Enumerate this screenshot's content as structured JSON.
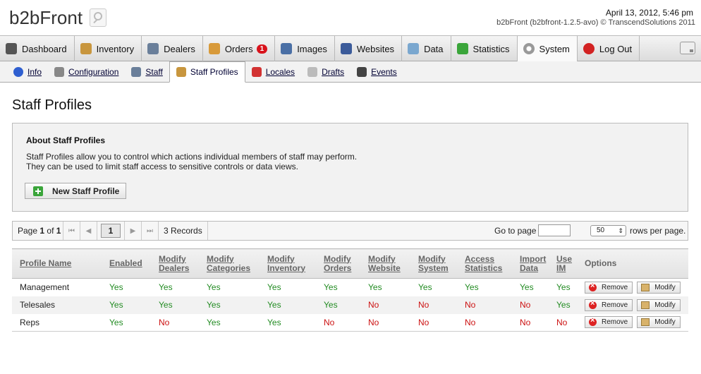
{
  "app": {
    "logo": "b2bFront",
    "datetime": "April 13, 2012, 5:46 pm",
    "version": "b2bFront (b2bfront-1.2.5-avo) © TranscendSolutions 2011"
  },
  "nav": {
    "tabs": [
      {
        "label": "Dashboard",
        "icon": "speedometer-icon",
        "color": "#555555"
      },
      {
        "label": "Inventory",
        "icon": "box-icon",
        "color": "#c8963e"
      },
      {
        "label": "Dealers",
        "icon": "person-icon",
        "color": "#6a7f9a"
      },
      {
        "label": "Orders",
        "icon": "orders-icon",
        "color": "#d89a3a",
        "badge": "1"
      },
      {
        "label": "Images",
        "icon": "images-icon",
        "color": "#4a6fa5"
      },
      {
        "label": "Websites",
        "icon": "website-icon",
        "color": "#3b5b9a"
      },
      {
        "label": "Data",
        "icon": "data-icon",
        "color": "#7aa7cf"
      },
      {
        "label": "Statistics",
        "icon": "chart-icon",
        "color": "#3aa53a"
      },
      {
        "label": "System",
        "icon": "gear-icon",
        "color": "#999999",
        "active": true
      },
      {
        "label": "Log Out",
        "icon": "logout-icon",
        "color": "#d22222"
      }
    ]
  },
  "subnav": {
    "tabs": [
      {
        "label": "Info",
        "icon": "info-icon",
        "color": "#2f5fd0"
      },
      {
        "label": "Configuration",
        "icon": "wrench-icon",
        "color": "#888888"
      },
      {
        "label": "Staff",
        "icon": "staff-icon",
        "color": "#6a7f9a"
      },
      {
        "label": "Staff Profiles",
        "icon": "staff-profiles-icon",
        "color": "#c8963e",
        "active": true
      },
      {
        "label": "Locales",
        "icon": "flag-icon",
        "color": "#d23232"
      },
      {
        "label": "Drafts",
        "icon": "document-icon",
        "color": "#bbbbbb"
      },
      {
        "label": "Events",
        "icon": "monitor-icon",
        "color": "#444444"
      }
    ]
  },
  "page": {
    "title": "Staff Profiles",
    "about_title": "About Staff Profiles",
    "about_line1": "Staff Profiles allow you to control which actions individual members of staff may perform.",
    "about_line2": "They can be used to limit staff access to sensitive controls or data views.",
    "new_button": "New Staff Profile"
  },
  "pager": {
    "page_label": "Page",
    "page_num": "1",
    "of_label": "of",
    "page_total": "1",
    "first": "⏮",
    "prev": "◀",
    "current": "1",
    "next": "▶",
    "last": "⏭",
    "records": "3 Records",
    "goto_label": "Go to page",
    "rows_value": "50",
    "rows_label": "rows per page."
  },
  "table": {
    "headers": [
      {
        "line1": "Profile Name",
        "line2": ""
      },
      {
        "line1": "Enabled",
        "line2": ""
      },
      {
        "line1": "Modify",
        "line2": "Dealers"
      },
      {
        "line1": "Modify",
        "line2": "Categories"
      },
      {
        "line1": "Modify",
        "line2": "Inventory"
      },
      {
        "line1": "Modify",
        "line2": "Orders"
      },
      {
        "line1": "Modify",
        "line2": "Website"
      },
      {
        "line1": "Modify",
        "line2": "System"
      },
      {
        "line1": "Access",
        "line2": "Statistics"
      },
      {
        "line1": "Import",
        "line2": "Data"
      },
      {
        "line1": "Use",
        "line2": "IM"
      },
      {
        "line1": "Options",
        "line2": ""
      }
    ],
    "remove_label": "Remove",
    "modify_label": "Modify",
    "rows": [
      {
        "name": "Management",
        "values": [
          "Yes",
          "Yes",
          "Yes",
          "Yes",
          "Yes",
          "Yes",
          "Yes",
          "Yes",
          "Yes",
          "Yes"
        ]
      },
      {
        "name": "Telesales",
        "values": [
          "Yes",
          "Yes",
          "Yes",
          "Yes",
          "Yes",
          "No",
          "No",
          "No",
          "No",
          "Yes"
        ]
      },
      {
        "name": "Reps",
        "values": [
          "Yes",
          "No",
          "Yes",
          "Yes",
          "No",
          "No",
          "No",
          "No",
          "No",
          "No"
        ]
      }
    ]
  }
}
